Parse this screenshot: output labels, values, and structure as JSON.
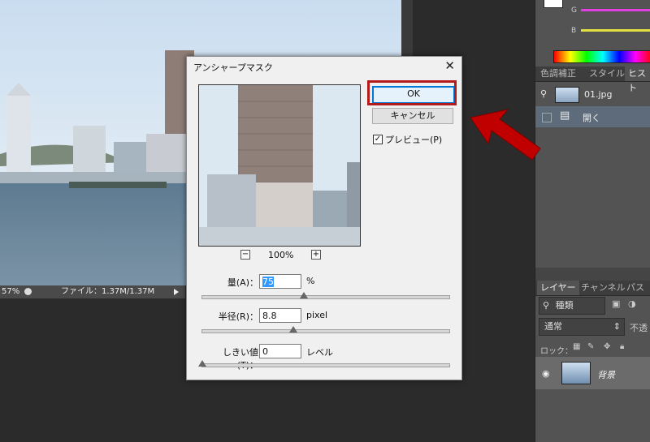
{
  "canvas": {
    "status_zoom": "57%",
    "status_file": "ファイル：1.37M/1.37M"
  },
  "color_panel": {
    "g_label": "G",
    "b_label": "B",
    "g_color": "#e040e0",
    "b_color": "#e0e040"
  },
  "adjust_tabs": [
    "色調補正",
    "スタイル",
    "ヒスト"
  ],
  "history": {
    "snapshot_name": "01.jpg",
    "step_label": "開く"
  },
  "layers_tabs": [
    "レイヤー",
    "チャンネル",
    "パス"
  ],
  "layers": {
    "filter_kind": "種類",
    "blend_mode": "通常",
    "opacity_label": "不透",
    "lock_label": "ロック：",
    "layer_name": "背景"
  },
  "dialog": {
    "title": "アンシャープマスク",
    "ok_label": "OK",
    "cancel_label": "キャンセル",
    "preview_label": "プレビュー(P)",
    "preview_checked": true,
    "zoom_level": "100%",
    "amount": {
      "label": "量(A)：",
      "value": "75",
      "unit": "%",
      "slider_fraction": 0.41
    },
    "radius": {
      "label": "半径(R)：",
      "value": "8.8",
      "unit": "pixel",
      "slider_fraction": 0.37
    },
    "threshold": {
      "label": "しきい値(T)：",
      "value": "0",
      "unit": "レベル",
      "slider_fraction": 0.0
    }
  },
  "colors": {
    "highlight_red": "#b31b1b",
    "arrow_red": "#c00000",
    "ok_border": "#0078d7"
  }
}
